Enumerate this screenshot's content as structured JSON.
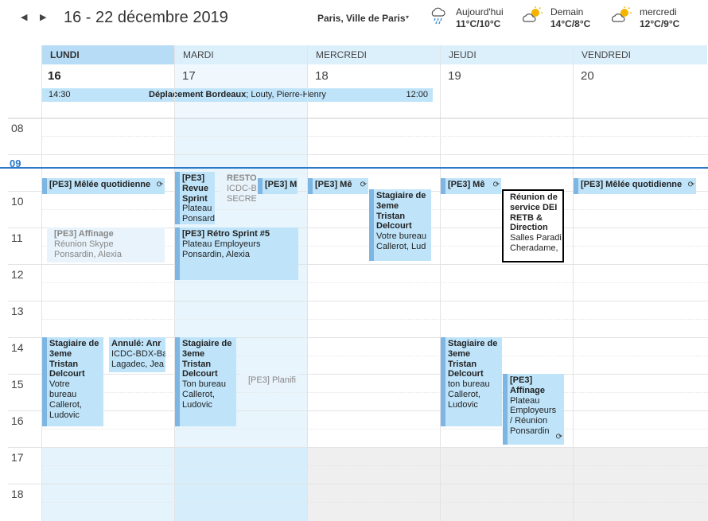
{
  "header": {
    "prev_icon": "caret-left",
    "next_icon": "caret-right",
    "date_range": "16 - 22 décembre 2019",
    "location": "Paris, Ville de Paris",
    "location_caret": "▾"
  },
  "weather": [
    {
      "label": "Aujourd'hui",
      "temp": "11°C/10°C",
      "icon": "rain-cloud"
    },
    {
      "label": "Demain",
      "temp": "14°C/8°C",
      "icon": "sun-cloud"
    },
    {
      "label": "mercredi",
      "temp": "12°C/9°C",
      "icon": "sun-cloud"
    }
  ],
  "days": [
    {
      "name": "LUNDI",
      "num": "16"
    },
    {
      "name": "MARDI",
      "num": "17"
    },
    {
      "name": "MERCREDI",
      "num": "18"
    },
    {
      "name": "JEUDI",
      "num": "19"
    },
    {
      "name": "VENDREDI",
      "num": "20"
    }
  ],
  "allday": {
    "start": "14:30",
    "title": "Déplacement Bordeaux",
    "who": "; Louty, Pierre-Henry",
    "end": "12:00"
  },
  "hours": [
    "08",
    "09",
    "10",
    "11",
    "12",
    "13",
    "14",
    "15",
    "16",
    "17",
    "18"
  ],
  "events": {
    "mon_melee": {
      "title": "[PE3] Mêlée quotidienne"
    },
    "tue_revue": {
      "title": "[PE3] Revue Sprint",
      "lines": [
        "Plateau",
        "Ponsard"
      ]
    },
    "tue_resto": {
      "title": "RESTO",
      "lines": [
        "ICDC-BI",
        "SECRET"
      ]
    },
    "tue_melee": {
      "title": "[PE3] M"
    },
    "wed_melee": {
      "title": "[PE3] Mê"
    },
    "thu_melee": {
      "title": "[PE3] Mê"
    },
    "fri_melee": {
      "title": "[PE3] Mêlée quotidienne"
    },
    "wed_stagiaire": {
      "title": "Stagiaire de 3eme Tristan Delcourt",
      "lines": [
        "Votre bureau",
        "Callerot, Lud"
      ]
    },
    "thu_reunion": {
      "title": "Réunion de service DEI RETB & Direction",
      "lines": [
        "Salles Paradi",
        "Cheradame,"
      ]
    },
    "mon_affinage": {
      "title": "[PE3] Affinage",
      "lines": [
        "Réunion Skype",
        "Ponsardin, Alexia"
      ]
    },
    "tue_retro": {
      "title": "[PE3] Rétro Sprint #5",
      "lines": [
        "Plateau Employeurs",
        "Ponsardin, Alexia"
      ]
    },
    "mon_stagiaire": {
      "title": "Stagiaire de 3eme Tristan Delcourt",
      "lines": [
        "Votre",
        "bureau",
        "Callerot,",
        "Ludovic"
      ]
    },
    "mon_annule": {
      "title": "Annulé: Anr",
      "lines": [
        "ICDC-BDX-Ba",
        "Lagadec, Jea"
      ]
    },
    "tue_stagiaire": {
      "title": "Stagiaire de 3eme Tristan Delcourt",
      "lines": [
        "Ton bureau",
        "Callerot,",
        "Ludovic"
      ]
    },
    "tue_planif": {
      "title": "[PE3] Planifi"
    },
    "thu_stagiaire": {
      "title": "Stagiaire de 3eme Tristan Delcourt",
      "lines": [
        "ton bureau",
        "Callerot,",
        "Ludovic"
      ]
    },
    "thu_affinage": {
      "title": "[PE3] Affinage",
      "lines": [
        "Plateau",
        "Employeurs",
        "/ Réunion",
        "Ponsardin"
      ]
    }
  }
}
